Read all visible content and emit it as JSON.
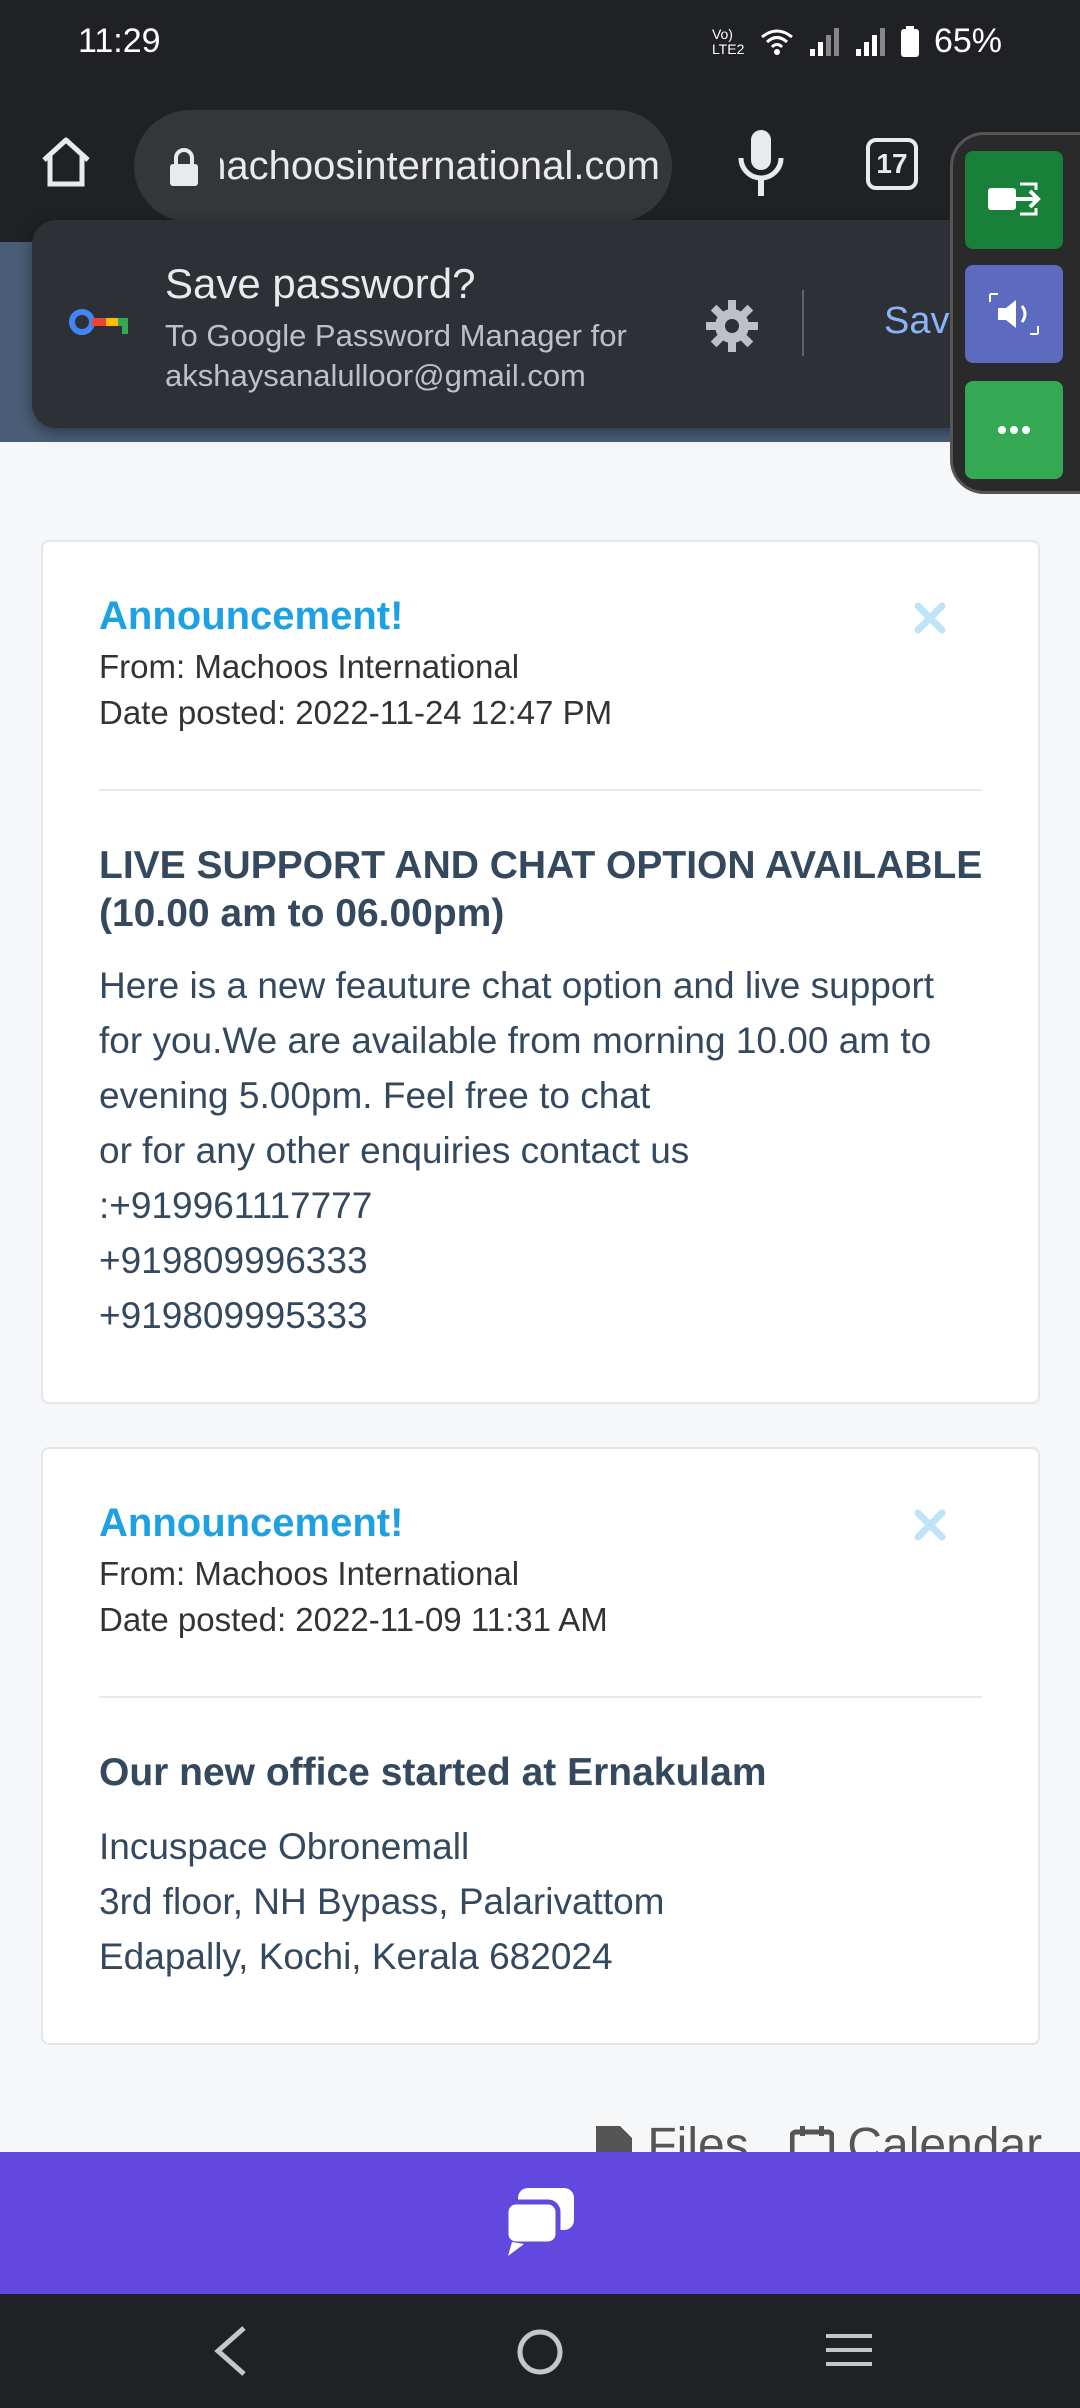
{
  "status_bar": {
    "time": "11:29",
    "network_label": "Vo) LTE2",
    "battery": "65%"
  },
  "browser": {
    "url": "machoosinternational.com",
    "tab_count": "17"
  },
  "save_password": {
    "title": "Save password?",
    "subtitle": "To Google Password Manager for",
    "account": "akshaysanalulloor@gmail.com",
    "save_label": "Save"
  },
  "announcements": [
    {
      "title": "Announcement!",
      "from": "From: Machoos International",
      "date": "Date posted: 2022-11-24 12:47 PM",
      "heading": "LIVE SUPPORT AND CHAT OPTION AVAILABLE (10.00 am to 06.00pm)",
      "body": [
        "Here is a new feauture chat option and live support",
        "for you.We are available from morning 10.00 am to",
        "evening 5.00pm. Feel free to chat",
        "or for any other enquiries contact us",
        ":+919961117777",
        "+919809996333",
        "+919809995333"
      ]
    },
    {
      "title": "Announcement!",
      "from": "From: Machoos International",
      "date": "Date posted: 2022-11-09 11:31 AM",
      "heading": "Our new office started at Ernakulam",
      "body": [
        "Incuspace Obronemall",
        "3rd floor, NH Bypass, Palarivattom",
        "Edapally, Kochi, Kerala 682024"
      ]
    }
  ],
  "footer": {
    "files_label": "Files",
    "calendar_label": "Calendar"
  },
  "colors": {
    "announcement_title": "#1ea1e3",
    "body_text": "#34495e",
    "chat_bar": "#6348e0",
    "floating_btn_1": "#188038",
    "floating_btn_2": "#5c6bc0",
    "floating_btn_3": "#34a853"
  }
}
